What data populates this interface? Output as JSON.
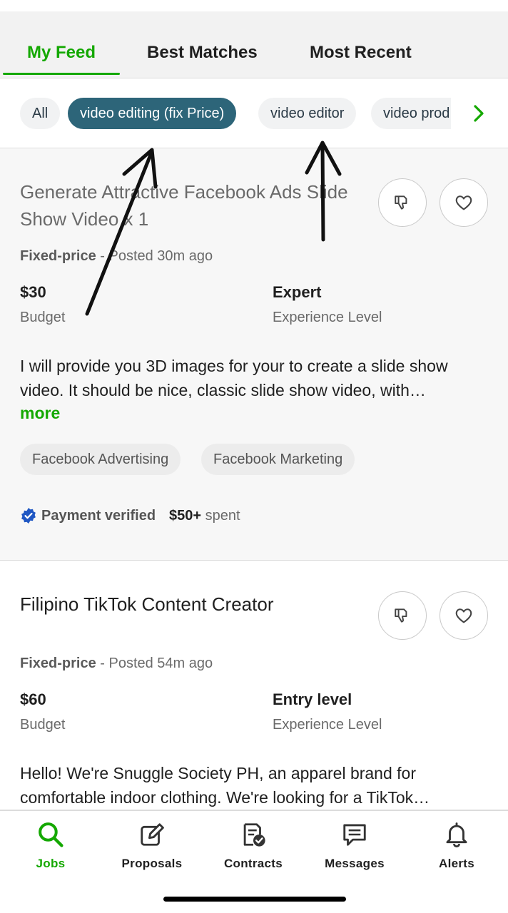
{
  "tabs": [
    {
      "label": "My Feed",
      "active": true
    },
    {
      "label": "Best Matches",
      "active": false
    },
    {
      "label": "Most Recent",
      "active": false
    }
  ],
  "filters": {
    "chips": [
      {
        "label": "All",
        "selected": false
      },
      {
        "label": "video editing (fix Price)",
        "selected": true
      },
      {
        "label": "video editor",
        "selected": false
      },
      {
        "label": "video prod",
        "selected": false
      }
    ],
    "next_icon": "chevron-right-icon"
  },
  "jobs": [
    {
      "title": "Generate Attractive Facebook Ads Slide Show Video x 1",
      "job_type": "Fixed-price",
      "posted": " - Posted 30m ago",
      "budget_value": "$30",
      "budget_label": "Budget",
      "experience_value": "Expert",
      "experience_label": "Experience Level",
      "description": "I will provide you 3D images for your to create a slide show video. It should be nice, classic slide show video, with…",
      "more_label": "more",
      "skills": [
        "Facebook Advertising",
        "Facebook Marketing"
      ],
      "payment_status": "Payment verified",
      "spent_amount": "$50+",
      "spent_label": " spent"
    },
    {
      "title": "Filipino TikTok Content Creator",
      "job_type": "Fixed-price",
      "posted": " - Posted 54m ago",
      "budget_value": "$60",
      "budget_label": "Budget",
      "experience_value": "Entry level",
      "experience_label": "Experience Level",
      "description": "Hello! We're Snuggle Society PH, an apparel brand for comfortable indoor clothing. We're looking for a TikTok…"
    }
  ],
  "bottom_nav": [
    {
      "label": "Jobs",
      "icon": "search-icon",
      "active": true
    },
    {
      "label": "Proposals",
      "icon": "edit-icon",
      "active": false
    },
    {
      "label": "Contracts",
      "icon": "contract-icon",
      "active": false
    },
    {
      "label": "Messages",
      "icon": "message-icon",
      "active": false
    },
    {
      "label": "Alerts",
      "icon": "bell-icon",
      "active": false
    }
  ],
  "colors": {
    "accent": "#14a800",
    "chip_selected": "#2d6579",
    "verified_badge": "#1f57c3"
  }
}
